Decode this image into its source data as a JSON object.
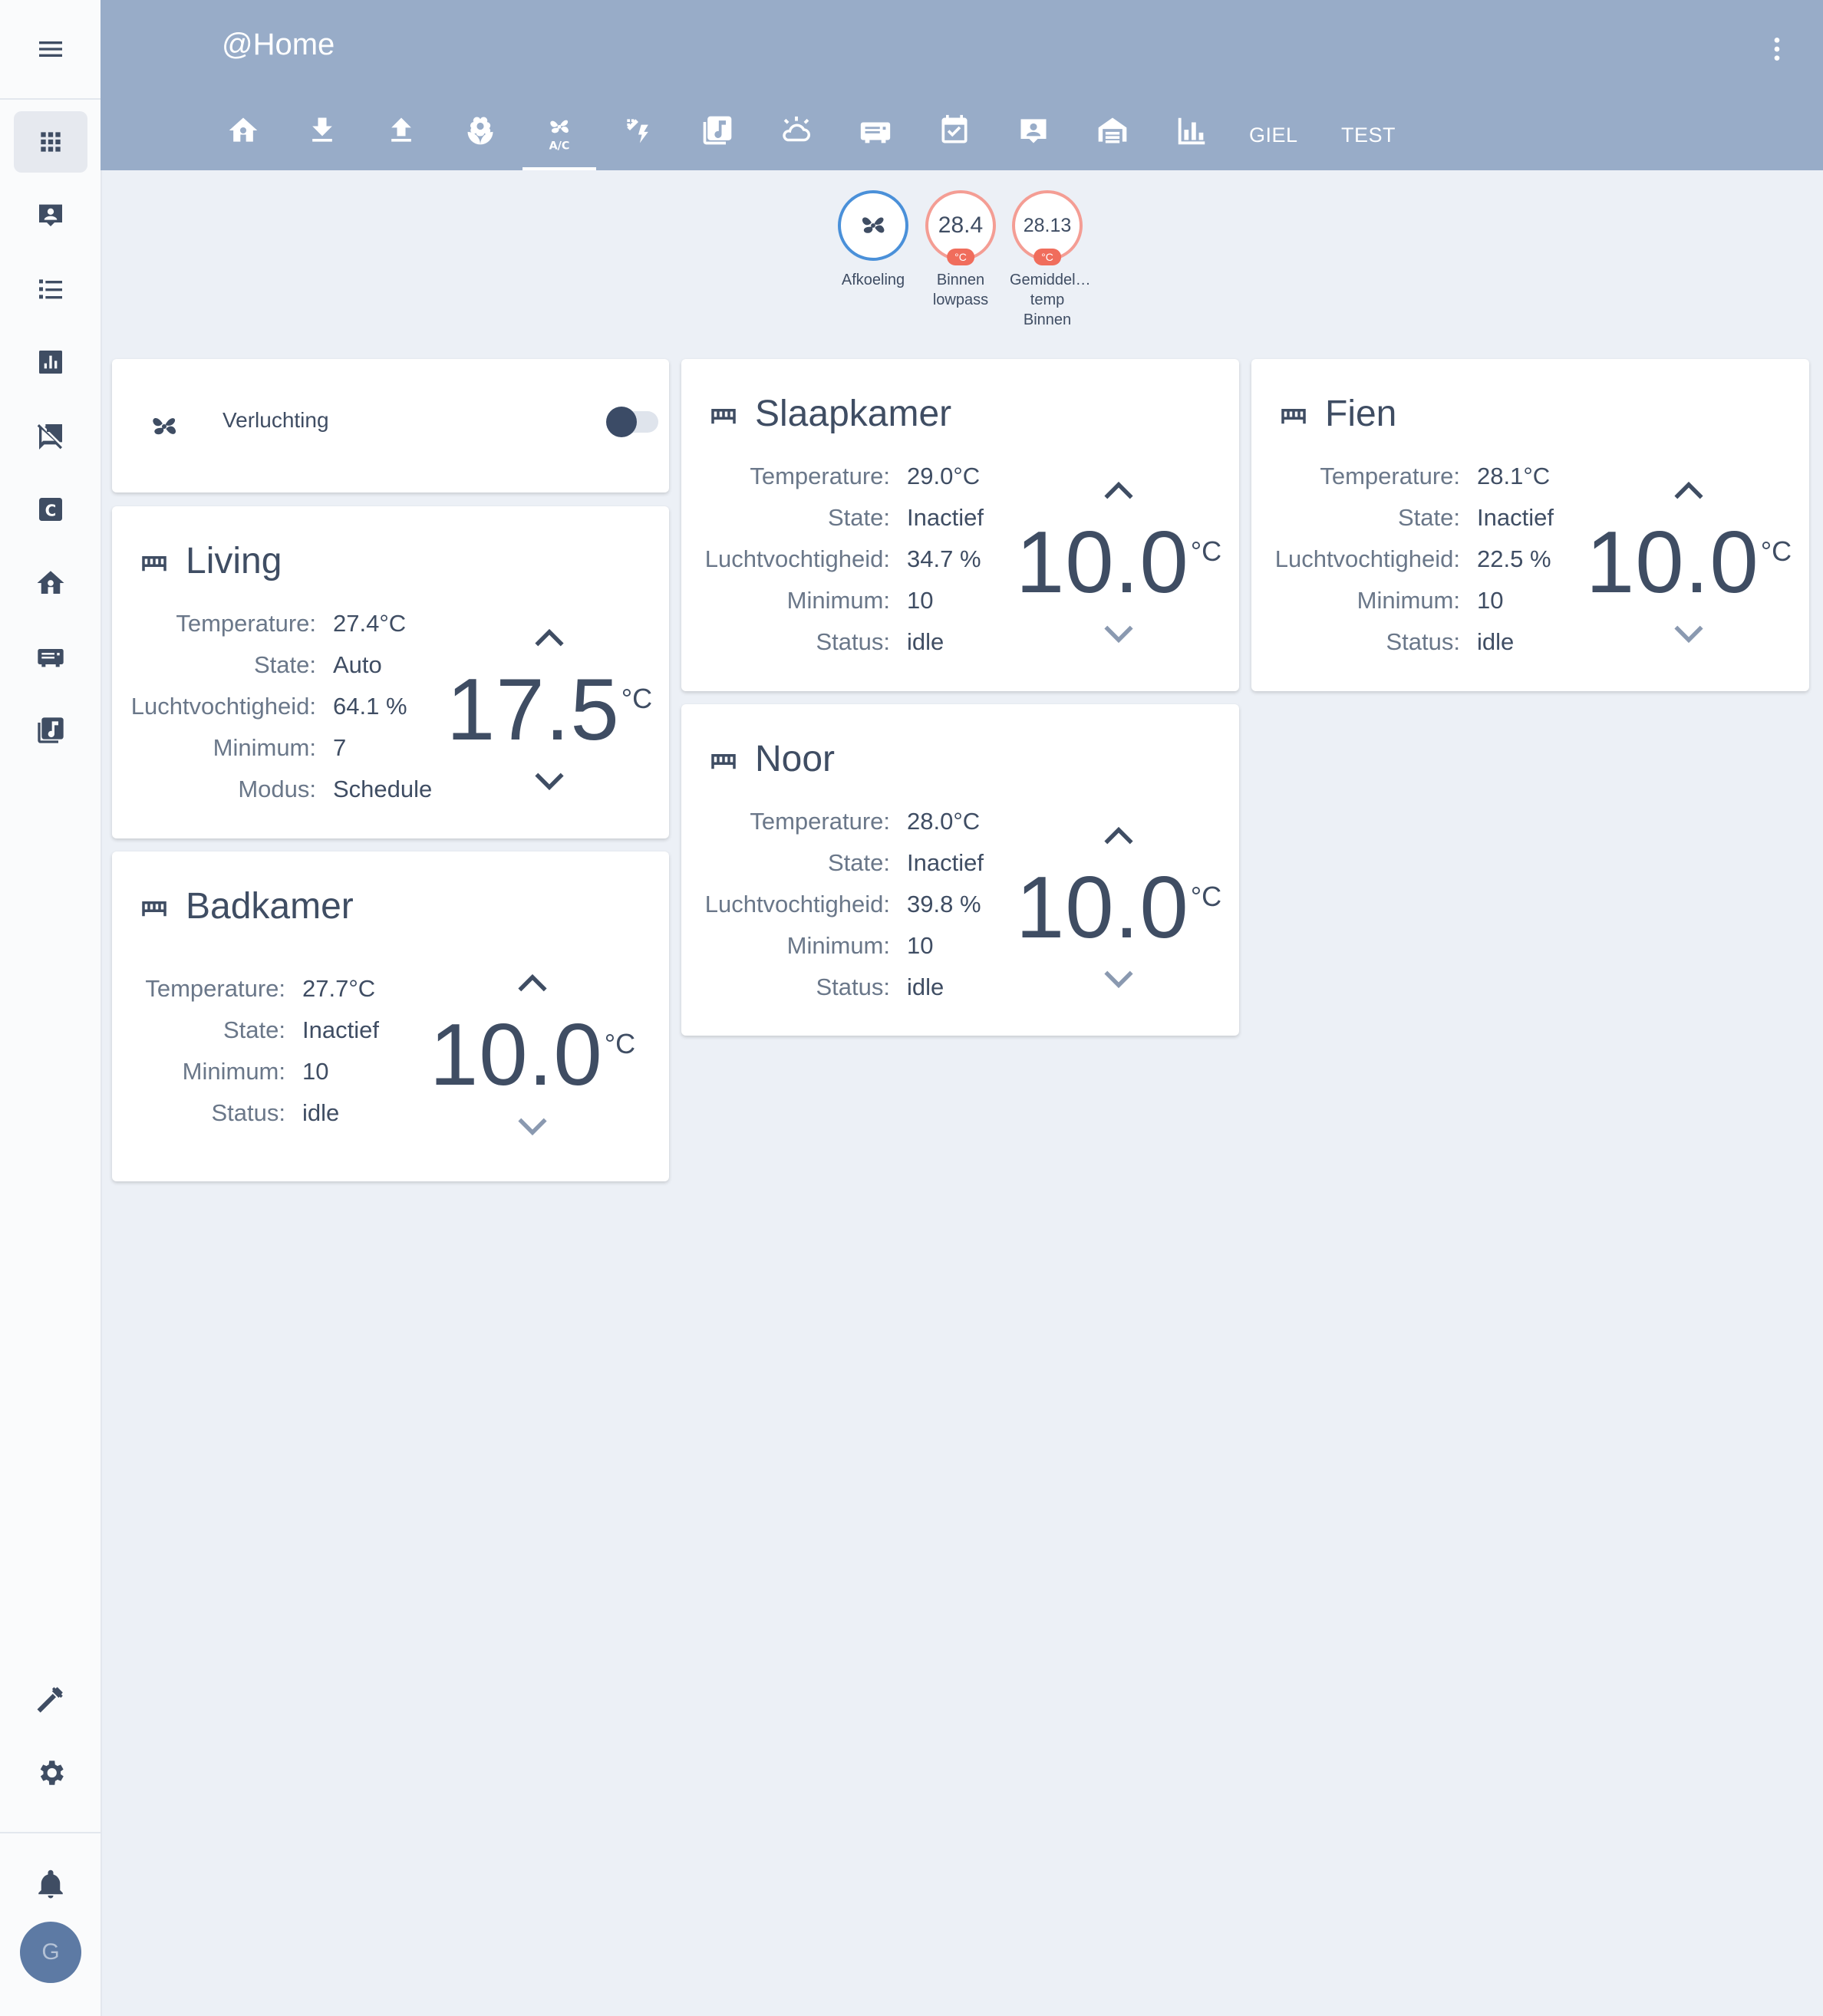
{
  "app": {
    "title": "@Home"
  },
  "header": {
    "tabs": [
      {
        "icon": "home-flower-icon"
      },
      {
        "icon": "download-icon"
      },
      {
        "icon": "upload-icon"
      },
      {
        "icon": "flower-icon"
      },
      {
        "icon": "ac-fan-icon",
        "sub": "A/C",
        "active": true
      },
      {
        "icon": "weather-lightning-icon"
      },
      {
        "icon": "music-box-icon"
      },
      {
        "icon": "weather-partly-cloudy-icon"
      },
      {
        "icon": "receiver-icon"
      },
      {
        "icon": "calendar-check-icon"
      },
      {
        "icon": "account-box-icon"
      },
      {
        "icon": "garage-icon"
      },
      {
        "icon": "bar-chart-icon"
      }
    ],
    "text_tabs": [
      "GIEL",
      "TEST"
    ]
  },
  "sidebar": {
    "items": [
      {
        "icon": "apps-grid-icon",
        "active": true
      },
      {
        "icon": "account-box-icon"
      },
      {
        "icon": "format-list-icon"
      },
      {
        "icon": "chart-box-icon"
      },
      {
        "icon": "message-off-icon"
      },
      {
        "icon": "letter-c-box-icon"
      },
      {
        "icon": "home-flower-icon"
      },
      {
        "icon": "receiver-icon"
      },
      {
        "icon": "music-box-icon"
      }
    ],
    "bottom": [
      {
        "icon": "hammer-icon"
      },
      {
        "icon": "gear-icon"
      },
      {
        "icon": "bell-icon"
      }
    ],
    "avatar_initial": "G"
  },
  "badges": [
    {
      "label": "Afkoeling",
      "value": "",
      "icon": "fan-icon"
    },
    {
      "label_lines": [
        "Binnen",
        "lowpass"
      ],
      "value": "28.4",
      "unit": "°C"
    },
    {
      "label_lines": [
        "Gemiddel…",
        "temp",
        "Binnen"
      ],
      "value": "28.13",
      "unit": "°C"
    }
  ],
  "fan_card": {
    "label": "Verluchting",
    "toggle_on": false,
    "icon": "fan-icon"
  },
  "thermostats": {
    "living": {
      "name": "Living",
      "attrs": [
        {
          "k": "Temperature:",
          "v": "27.4°C"
        },
        {
          "k": "State:",
          "v": "Auto"
        },
        {
          "k": "Luchtvochtigheid:",
          "v": "64.1 %"
        },
        {
          "k": "Minimum:",
          "v": "7"
        },
        {
          "k": "Modus:",
          "v": "Schedule"
        }
      ],
      "setpoint": "17.5",
      "unit": "°C"
    },
    "badkamer": {
      "name": "Badkamer",
      "attrs": [
        {
          "k": "Temperature:",
          "v": "27.7°C"
        },
        {
          "k": "State:",
          "v": "Inactief"
        },
        {
          "k": "Minimum:",
          "v": "10"
        },
        {
          "k": "Status:",
          "v": "idle"
        }
      ],
      "setpoint": "10.0",
      "unit": "°C"
    },
    "slaapkamer": {
      "name": "Slaapkamer",
      "attrs": [
        {
          "k": "Temperature:",
          "v": "29.0°C"
        },
        {
          "k": "State:",
          "v": "Inactief"
        },
        {
          "k": "Luchtvochtigheid:",
          "v": "34.7 %"
        },
        {
          "k": "Minimum:",
          "v": "10"
        },
        {
          "k": "Status:",
          "v": "idle"
        }
      ],
      "setpoint": "10.0",
      "unit": "°C"
    },
    "noor": {
      "name": "Noor",
      "attrs": [
        {
          "k": "Temperature:",
          "v": "28.0°C"
        },
        {
          "k": "State:",
          "v": "Inactief"
        },
        {
          "k": "Luchtvochtigheid:",
          "v": "39.8 %"
        },
        {
          "k": "Minimum:",
          "v": "10"
        },
        {
          "k": "Status:",
          "v": "idle"
        }
      ],
      "setpoint": "10.0",
      "unit": "°C"
    },
    "fien": {
      "name": "Fien",
      "attrs": [
        {
          "k": "Temperature:",
          "v": "28.1°C"
        },
        {
          "k": "State:",
          "v": "Inactief"
        },
        {
          "k": "Luchtvochtigheid:",
          "v": "22.5 %"
        },
        {
          "k": "Minimum:",
          "v": "10"
        },
        {
          "k": "Status:",
          "v": "idle"
        }
      ],
      "setpoint": "10.0",
      "unit": "°C"
    }
  },
  "colors": {
    "header": "#98acc8",
    "background": "#ecf0f6",
    "text": "#3f4d63",
    "heat_ring": "#f49d94",
    "cool_ring": "#4a90d9"
  }
}
